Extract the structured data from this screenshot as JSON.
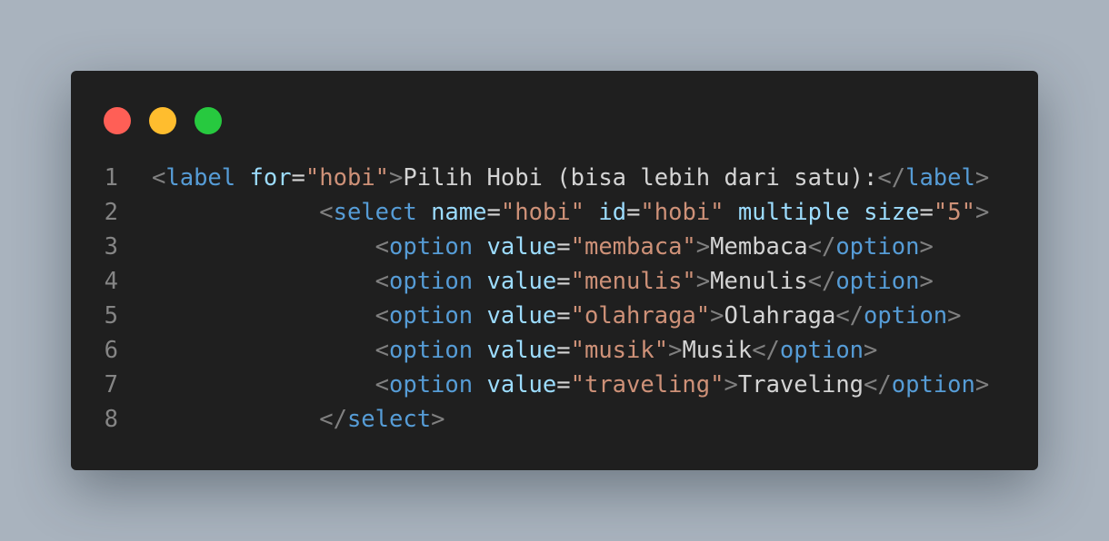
{
  "window": {
    "controls": [
      {
        "name": "close",
        "color": "#ff5f56"
      },
      {
        "name": "minimize",
        "color": "#ffbd2e"
      },
      {
        "name": "maximize",
        "color": "#27c93f"
      }
    ]
  },
  "code": {
    "line_numbers": [
      "1",
      "2",
      "3",
      "4",
      "5",
      "6",
      "7",
      "8"
    ],
    "lines": [
      {
        "indent": "",
        "tokens": [
          {
            "k": "p",
            "v": "<"
          },
          {
            "k": "t",
            "v": "label"
          },
          {
            "k": "x",
            "v": " "
          },
          {
            "k": "a",
            "v": "for"
          },
          {
            "k": "x",
            "v": "="
          },
          {
            "k": "s",
            "v": "\"hobi\""
          },
          {
            "k": "p",
            "v": ">"
          },
          {
            "k": "x",
            "v": "Pilih Hobi (bisa lebih dari satu):"
          },
          {
            "k": "p",
            "v": "</"
          },
          {
            "k": "t",
            "v": "label"
          },
          {
            "k": "p",
            "v": ">"
          }
        ]
      },
      {
        "indent": "            ",
        "tokens": [
          {
            "k": "p",
            "v": "<"
          },
          {
            "k": "t",
            "v": "select"
          },
          {
            "k": "x",
            "v": " "
          },
          {
            "k": "a",
            "v": "name"
          },
          {
            "k": "x",
            "v": "="
          },
          {
            "k": "s",
            "v": "\"hobi\""
          },
          {
            "k": "x",
            "v": " "
          },
          {
            "k": "a",
            "v": "id"
          },
          {
            "k": "x",
            "v": "="
          },
          {
            "k": "s",
            "v": "\"hobi\""
          },
          {
            "k": "x",
            "v": " "
          },
          {
            "k": "a",
            "v": "multiple"
          },
          {
            "k": "x",
            "v": " "
          },
          {
            "k": "a",
            "v": "size"
          },
          {
            "k": "x",
            "v": "="
          },
          {
            "k": "s",
            "v": "\"5\""
          },
          {
            "k": "p",
            "v": ">"
          }
        ]
      },
      {
        "indent": "                ",
        "tokens": [
          {
            "k": "p",
            "v": "<"
          },
          {
            "k": "t",
            "v": "option"
          },
          {
            "k": "x",
            "v": " "
          },
          {
            "k": "a",
            "v": "value"
          },
          {
            "k": "x",
            "v": "="
          },
          {
            "k": "s",
            "v": "\"membaca\""
          },
          {
            "k": "p",
            "v": ">"
          },
          {
            "k": "x",
            "v": "Membaca"
          },
          {
            "k": "p",
            "v": "</"
          },
          {
            "k": "t",
            "v": "option"
          },
          {
            "k": "p",
            "v": ">"
          }
        ]
      },
      {
        "indent": "                ",
        "tokens": [
          {
            "k": "p",
            "v": "<"
          },
          {
            "k": "t",
            "v": "option"
          },
          {
            "k": "x",
            "v": " "
          },
          {
            "k": "a",
            "v": "value"
          },
          {
            "k": "x",
            "v": "="
          },
          {
            "k": "s",
            "v": "\"menulis\""
          },
          {
            "k": "p",
            "v": ">"
          },
          {
            "k": "x",
            "v": "Menulis"
          },
          {
            "k": "p",
            "v": "</"
          },
          {
            "k": "t",
            "v": "option"
          },
          {
            "k": "p",
            "v": ">"
          }
        ]
      },
      {
        "indent": "                ",
        "tokens": [
          {
            "k": "p",
            "v": "<"
          },
          {
            "k": "t",
            "v": "option"
          },
          {
            "k": "x",
            "v": " "
          },
          {
            "k": "a",
            "v": "value"
          },
          {
            "k": "x",
            "v": "="
          },
          {
            "k": "s",
            "v": "\"olahraga\""
          },
          {
            "k": "p",
            "v": ">"
          },
          {
            "k": "x",
            "v": "Olahraga"
          },
          {
            "k": "p",
            "v": "</"
          },
          {
            "k": "t",
            "v": "option"
          },
          {
            "k": "p",
            "v": ">"
          }
        ]
      },
      {
        "indent": "                ",
        "tokens": [
          {
            "k": "p",
            "v": "<"
          },
          {
            "k": "t",
            "v": "option"
          },
          {
            "k": "x",
            "v": " "
          },
          {
            "k": "a",
            "v": "value"
          },
          {
            "k": "x",
            "v": "="
          },
          {
            "k": "s",
            "v": "\"musik\""
          },
          {
            "k": "p",
            "v": ">"
          },
          {
            "k": "x",
            "v": "Musik"
          },
          {
            "k": "p",
            "v": "</"
          },
          {
            "k": "t",
            "v": "option"
          },
          {
            "k": "p",
            "v": ">"
          }
        ]
      },
      {
        "indent": "                ",
        "tokens": [
          {
            "k": "p",
            "v": "<"
          },
          {
            "k": "t",
            "v": "option"
          },
          {
            "k": "x",
            "v": " "
          },
          {
            "k": "a",
            "v": "value"
          },
          {
            "k": "x",
            "v": "="
          },
          {
            "k": "s",
            "v": "\"traveling\""
          },
          {
            "k": "p",
            "v": ">"
          },
          {
            "k": "x",
            "v": "Traveling"
          },
          {
            "k": "p",
            "v": "</"
          },
          {
            "k": "t",
            "v": "option"
          },
          {
            "k": "p",
            "v": ">"
          }
        ]
      },
      {
        "indent": "            ",
        "tokens": [
          {
            "k": "p",
            "v": "</"
          },
          {
            "k": "t",
            "v": "select"
          },
          {
            "k": "p",
            "v": ">"
          }
        ]
      }
    ]
  }
}
